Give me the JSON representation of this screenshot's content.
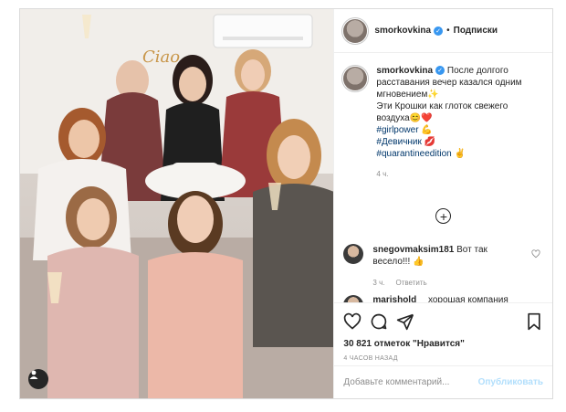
{
  "post": {
    "username": "smorkovkina",
    "follow_state": "Подписки",
    "caption": {
      "line1": "После долгого расставания вечер казался одним мгновением✨",
      "line2": "Эти Крошки как глоток свежего воздуха😊❤️",
      "hashtags": [
        "#girlpower 💪",
        "#Девичник 💋",
        "#quarantineedition ✌️"
      ],
      "time": "4 ч."
    },
    "comments": [
      {
        "username": "snegovmaksim181",
        "text": "Вот так весело!!! 👍",
        "time": "3 ч.",
        "reply_label": "Ответить"
      },
      {
        "username": "marishold",
        "text": "хорошая компания"
      }
    ],
    "likes_text": "30 821 отметок \"Нравится\"",
    "posted_ago": "4 ЧАСОВ НАЗАД",
    "comment_input": {
      "placeholder": "Добавьте комментарий..."
    },
    "publish_label": "Опубликовать",
    "photo_sign_text": "Ciao"
  },
  "colors": {
    "border": "#dbdbdb",
    "hashtag": "#00376b",
    "verified": "#3897f0",
    "muted": "#8e8e8e",
    "publish_disabled": "#b2dffc"
  },
  "icons": [
    "verified-badge-icon",
    "more-options-icon",
    "load-more-comments-icon",
    "heart-icon",
    "comment-icon",
    "share-icon",
    "bookmark-icon",
    "user-tag-icon"
  ]
}
